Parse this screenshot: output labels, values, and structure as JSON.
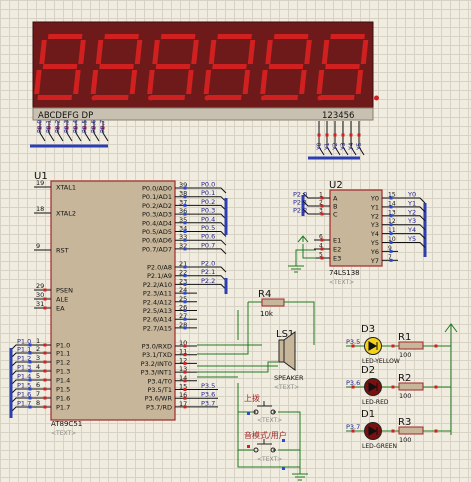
{
  "display": {
    "segment_labels": "ABCDEFG  DP",
    "digit_labels": "123456",
    "segment_pins": [
      "P0.0",
      "P0.1",
      "P0.2",
      "P0.3",
      "P0.4",
      "P0.5",
      "P0.6",
      "P0.7"
    ],
    "digit_pins": [
      "Y0",
      "Y1",
      "Y2",
      "Y3",
      "Y4",
      "Y5"
    ],
    "segment_color": "#d02020",
    "body_color": "#7a1e1e"
  },
  "mcu": {
    "ref": "U1",
    "part": "AT89C51",
    "text_placeholder": "<TEXT>",
    "left_pins": [
      {
        "num": "19",
        "name": "XTAL1"
      },
      {
        "num": "18",
        "name": "XTAL2"
      },
      {
        "num": "9",
        "name": "RST"
      },
      {
        "num": "29",
        "name": "PSEN"
      },
      {
        "num": "30",
        "name": "ALE"
      },
      {
        "num": "31",
        "name": "EA"
      },
      {
        "num": "1",
        "name": "P1.0"
      },
      {
        "num": "2",
        "name": "P1.1"
      },
      {
        "num": "3",
        "name": "P1.2"
      },
      {
        "num": "4",
        "name": "P1.3"
      },
      {
        "num": "5",
        "name": "P1.4"
      },
      {
        "num": "6",
        "name": "P1.5"
      },
      {
        "num": "7",
        "name": "P1.6"
      },
      {
        "num": "8",
        "name": "P1.7"
      }
    ],
    "port0": [
      {
        "num": "39",
        "name": "P0.0/AD0",
        "net": "P0.0"
      },
      {
        "num": "38",
        "name": "P0.1/AD1",
        "net": "P0.1"
      },
      {
        "num": "37",
        "name": "P0.2/AD2",
        "net": "P0.2"
      },
      {
        "num": "36",
        "name": "P0.3/AD3",
        "net": "P0.3"
      },
      {
        "num": "35",
        "name": "P0.4/AD4",
        "net": "P0.4"
      },
      {
        "num": "34",
        "name": "P0.5/AD5",
        "net": "P0.5"
      },
      {
        "num": "33",
        "name": "P0.6/AD6",
        "net": "P0.6"
      },
      {
        "num": "32",
        "name": "P0.7/AD7",
        "net": "P0.7"
      }
    ],
    "port2": [
      {
        "num": "21",
        "name": "P2.0/A8",
        "net": "P2.0"
      },
      {
        "num": "22",
        "name": "P2.1/A9",
        "net": "P2.1"
      },
      {
        "num": "23",
        "name": "P2.2/A10",
        "net": "P2.2"
      },
      {
        "num": "24",
        "name": "P2.3/A11",
        "net": ""
      },
      {
        "num": "25",
        "name": "P2.4/A12",
        "net": ""
      },
      {
        "num": "26",
        "name": "P2.5/A13",
        "net": ""
      },
      {
        "num": "27",
        "name": "P2.6/A14",
        "net": ""
      },
      {
        "num": "28",
        "name": "P2.7/A15",
        "net": ""
      }
    ],
    "port3": [
      {
        "num": "10",
        "name": "P3.0/RXD",
        "net": ""
      },
      {
        "num": "11",
        "name": "P3.1/TXD",
        "net": ""
      },
      {
        "num": "12",
        "name": "P3.2/INT0",
        "net": ""
      },
      {
        "num": "13",
        "name": "P3.3/INT1",
        "net": ""
      },
      {
        "num": "14",
        "name": "P3.4/T0",
        "net": ""
      },
      {
        "num": "15",
        "name": "P3.5/T1",
        "net": "P3.5"
      },
      {
        "num": "16",
        "name": "P3.6/WR",
        "net": "P3.6"
      },
      {
        "num": "17",
        "name": "P3.7/RD",
        "net": "P3.7"
      }
    ],
    "p1_nets": [
      "P1.0",
      "P1.1",
      "P1.2",
      "P1.3",
      "P1.4",
      "P1.5",
      "P1.6",
      "P1.7"
    ]
  },
  "decoder": {
    "ref": "U2",
    "part": "74LS138",
    "text_placeholder": "<TEXT>",
    "inputs": [
      {
        "num": "1",
        "name": "A",
        "net": "P2.0"
      },
      {
        "num": "2",
        "name": "B",
        "net": "P2.1"
      },
      {
        "num": "3",
        "name": "C",
        "net": "P2.2"
      },
      {
        "num": "6",
        "name": "E1",
        "net": ""
      },
      {
        "num": "4",
        "name": "E2",
        "net": ""
      },
      {
        "num": "5",
        "name": "E3",
        "net": ""
      }
    ],
    "outputs": [
      {
        "num": "15",
        "name": "Y0"
      },
      {
        "num": "14",
        "name": "Y1"
      },
      {
        "num": "13",
        "name": "Y2"
      },
      {
        "num": "12",
        "name": "Y3"
      },
      {
        "num": "11",
        "name": "Y4"
      },
      {
        "num": "10",
        "name": "Y5"
      },
      {
        "num": "9",
        "name": "Y6"
      },
      {
        "num": "7",
        "name": "Y7"
      }
    ]
  },
  "r4": {
    "ref": "R4",
    "value": "10k"
  },
  "speaker": {
    "ref": "LS1",
    "part": "SPEAKER",
    "text_placeholder": "<TEXT>"
  },
  "buttons": [
    {
      "label": "上拨",
      "text_placeholder": "<TEXT>",
      "net": "P3.5"
    },
    {
      "label": "音模式/用户",
      "text_placeholder": "<TEXT>",
      "net": "P3.7"
    }
  ],
  "leds": [
    {
      "ref": "D3",
      "part": "LED-YELLOW",
      "net": "P3.5",
      "color": "#f2d21c",
      "resistor": "R1",
      "value": "100"
    },
    {
      "ref": "D2",
      "part": "LED-RED",
      "net": "P3.6",
      "color": "#7a1010",
      "resistor": "R2",
      "value": "100"
    },
    {
      "ref": "D1",
      "part": "LED-GREEN",
      "net": "P3.7",
      "color": "#7a1010",
      "resistor": "R3",
      "value": "100"
    }
  ],
  "colors": {
    "wire": "#1f7a1f",
    "body": "#c7b69a",
    "outline": "#a0282a",
    "bus": "#2d3fb0",
    "text": "#1e1e8c",
    "pin_red": "#d62020",
    "pin_blue": "#2a4ad8"
  }
}
